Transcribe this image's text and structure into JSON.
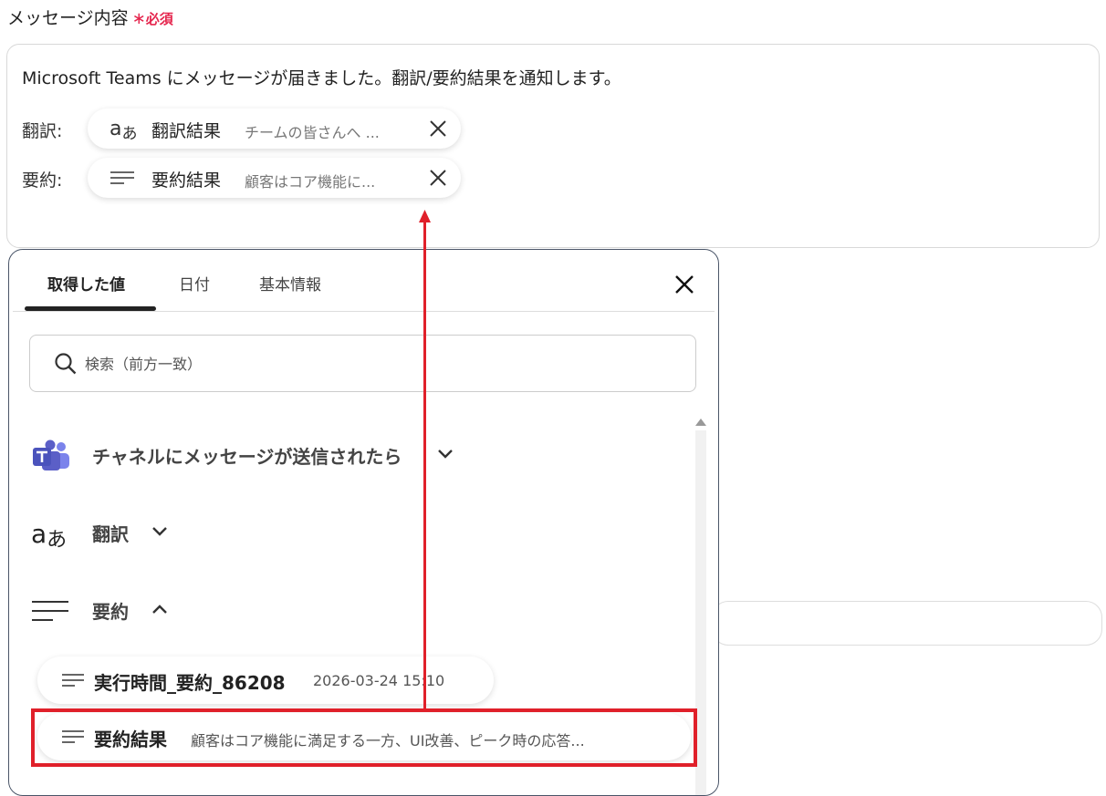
{
  "field": {
    "label": "メッセージ内容",
    "required_mark": "∗",
    "required": "必須"
  },
  "editor": {
    "message": "Microsoft Teams にメッセージが届きました。翻訳/要約結果を通知します。",
    "rows": [
      {
        "label": "翻訳:",
        "token_icon": "translate-icon",
        "token_name": "翻訳結果",
        "token_value": "チームの皆さんへ ..."
      },
      {
        "label": "要約:",
        "token_icon": "lines-icon",
        "token_name": "要約結果",
        "token_value": "顧客はコア機能に..."
      }
    ]
  },
  "panel": {
    "tabs": [
      {
        "label": "取得した値",
        "active": true
      },
      {
        "label": "日付",
        "active": false
      },
      {
        "label": "基本情報",
        "active": false
      }
    ],
    "search": {
      "placeholder": "検索（前方一致）",
      "value": ""
    },
    "groups": [
      {
        "label": "チャネルにメッセージが送信されたら",
        "icon": "teams-icon",
        "expanded": false
      },
      {
        "label": "翻訳",
        "icon": "translate-icon",
        "expanded": false
      },
      {
        "label": "要約",
        "icon": "lines-icon",
        "expanded": true
      }
    ],
    "items": [
      {
        "name": "実行時間_要約_86208",
        "value": "2026-03-24 15:10"
      },
      {
        "name": "要約結果",
        "value": "顧客はコア機能に満足する一方、UI改善、ピーク時の応答..."
      }
    ]
  },
  "colors": {
    "annotation": "#e0202a",
    "required": "#e5254d",
    "teams": "#5b5fc7"
  }
}
